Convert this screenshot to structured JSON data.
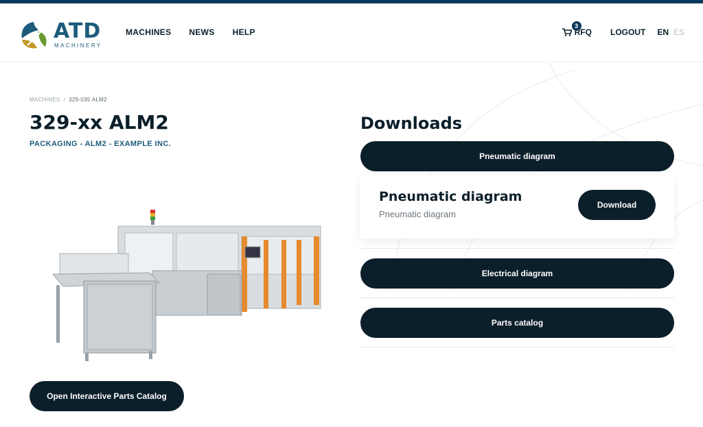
{
  "brand": {
    "name": "ATD",
    "tagline": "MACHINERY",
    "colors": {
      "primary": "#0d3a5c",
      "dark": "#0b1f2a",
      "accent_green": "#6a9a2f",
      "accent_gold": "#c79a2a"
    }
  },
  "nav": {
    "items": [
      "MACHINES",
      "NEWS",
      "HELP"
    ]
  },
  "header_right": {
    "cart_icon": "cart-icon",
    "cart_count": "3",
    "rfq_label": "RFQ",
    "logout_label": "LOGOUT",
    "lang_active": "EN",
    "lang_inactive": "ES"
  },
  "breadcrumb": {
    "root": "MACHINES",
    "separator": "/",
    "current": "329-035 ALM2"
  },
  "machine": {
    "title": "329-xx ALM2",
    "subtitle": "PACKAGING - ALM2 - EXAMPLE INC.",
    "open_catalog_label": "Open Interactive Parts Catalog"
  },
  "downloads": {
    "title": "Downloads",
    "items": [
      {
        "label": "Pneumatic diagram",
        "expanded": true,
        "file_title": "Pneumatic diagram",
        "file_desc": "Pneumatic diagram",
        "action": "Download"
      },
      {
        "label": "Electrical diagram",
        "expanded": false
      },
      {
        "label": "Parts catalog",
        "expanded": false
      }
    ]
  }
}
